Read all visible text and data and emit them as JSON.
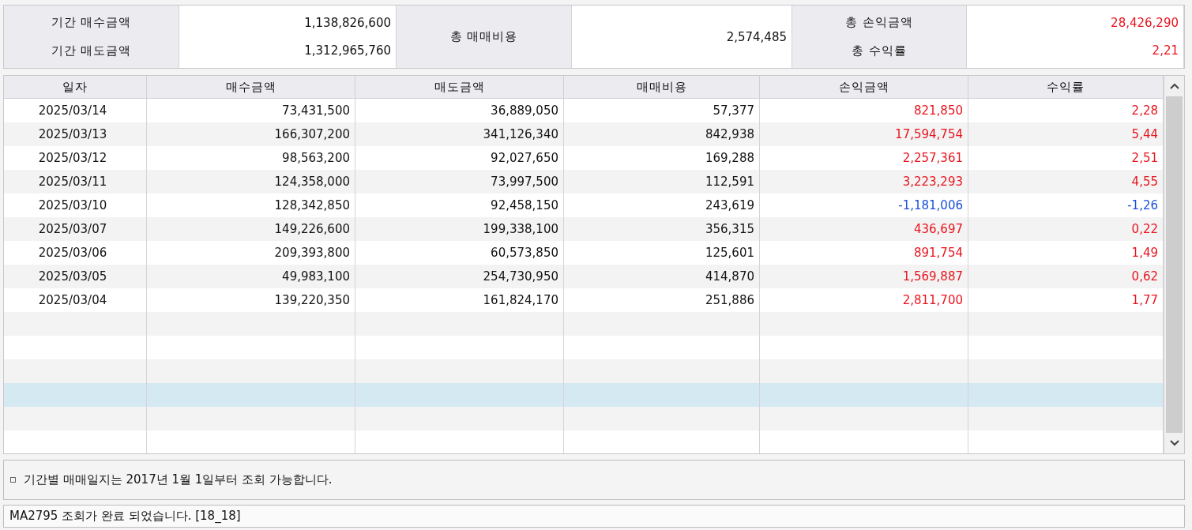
{
  "summary": [
    {
      "kind": "pair",
      "rows": [
        {
          "label": "기간 매수금액",
          "value": "1,138,826,600",
          "color": "#111111"
        },
        {
          "label": "기간 매도금액",
          "value": "1,312,965,760",
          "color": "#111111"
        }
      ]
    },
    {
      "kind": "single",
      "label": "총 매매비용",
      "value": "2,574,485",
      "color": "#111111"
    },
    {
      "kind": "pair",
      "rows": [
        {
          "label": "총 손익금액",
          "value": "28,426,290",
          "color": "#e8141e"
        },
        {
          "label": "총 수익률",
          "value": "2,21",
          "color": "#e8141e"
        }
      ]
    }
  ],
  "table": {
    "columns": [
      "일자",
      "매수금액",
      "매도금액",
      "매매비용",
      "손익금액",
      "수익률"
    ],
    "rows": [
      {
        "cells": [
          "2025/03/14",
          "73,431,500",
          "36,889,050",
          "57,377",
          "821,850",
          "2,28"
        ],
        "kind": "gain"
      },
      {
        "cells": [
          "2025/03/13",
          "166,307,200",
          "341,126,340",
          "842,938",
          "17,594,754",
          "5,44"
        ],
        "kind": "gain"
      },
      {
        "cells": [
          "2025/03/12",
          "98,563,200",
          "92,027,650",
          "169,288",
          "2,257,361",
          "2,51"
        ],
        "kind": "gain"
      },
      {
        "cells": [
          "2025/03/11",
          "124,358,000",
          "73,997,500",
          "112,591",
          "3,223,293",
          "4,55"
        ],
        "kind": "gain"
      },
      {
        "cells": [
          "2025/03/10",
          "128,342,850",
          "92,458,150",
          "243,619",
          "-1,181,006",
          "-1,26"
        ],
        "kind": "loss"
      },
      {
        "cells": [
          "2025/03/07",
          "149,226,600",
          "199,338,100",
          "356,315",
          "436,697",
          "0,22"
        ],
        "kind": "gain"
      },
      {
        "cells": [
          "2025/03/06",
          "209,393,800",
          "60,573,850",
          "125,601",
          "891,754",
          "1,49"
        ],
        "kind": "gain"
      },
      {
        "cells": [
          "2025/03/05",
          "49,983,100",
          "254,730,950",
          "414,870",
          "1,569,887",
          "0,62"
        ],
        "kind": "gain"
      },
      {
        "cells": [
          "2025/03/04",
          "139,220,350",
          "161,824,170",
          "251,886",
          "2,811,700",
          "1,77"
        ],
        "kind": "gain"
      }
    ],
    "empty_rows": [
      {
        "selected": false
      },
      {
        "selected": false
      },
      {
        "selected": false
      },
      {
        "selected": true
      },
      {
        "selected": false
      },
      {
        "selected": false
      }
    ]
  },
  "note": "기간별 매매일지는 2017년 1월 1일부터 조회 가능합니다.",
  "status_bar": "MA2795 조회가 완료 되었습니다. [18_18]"
}
